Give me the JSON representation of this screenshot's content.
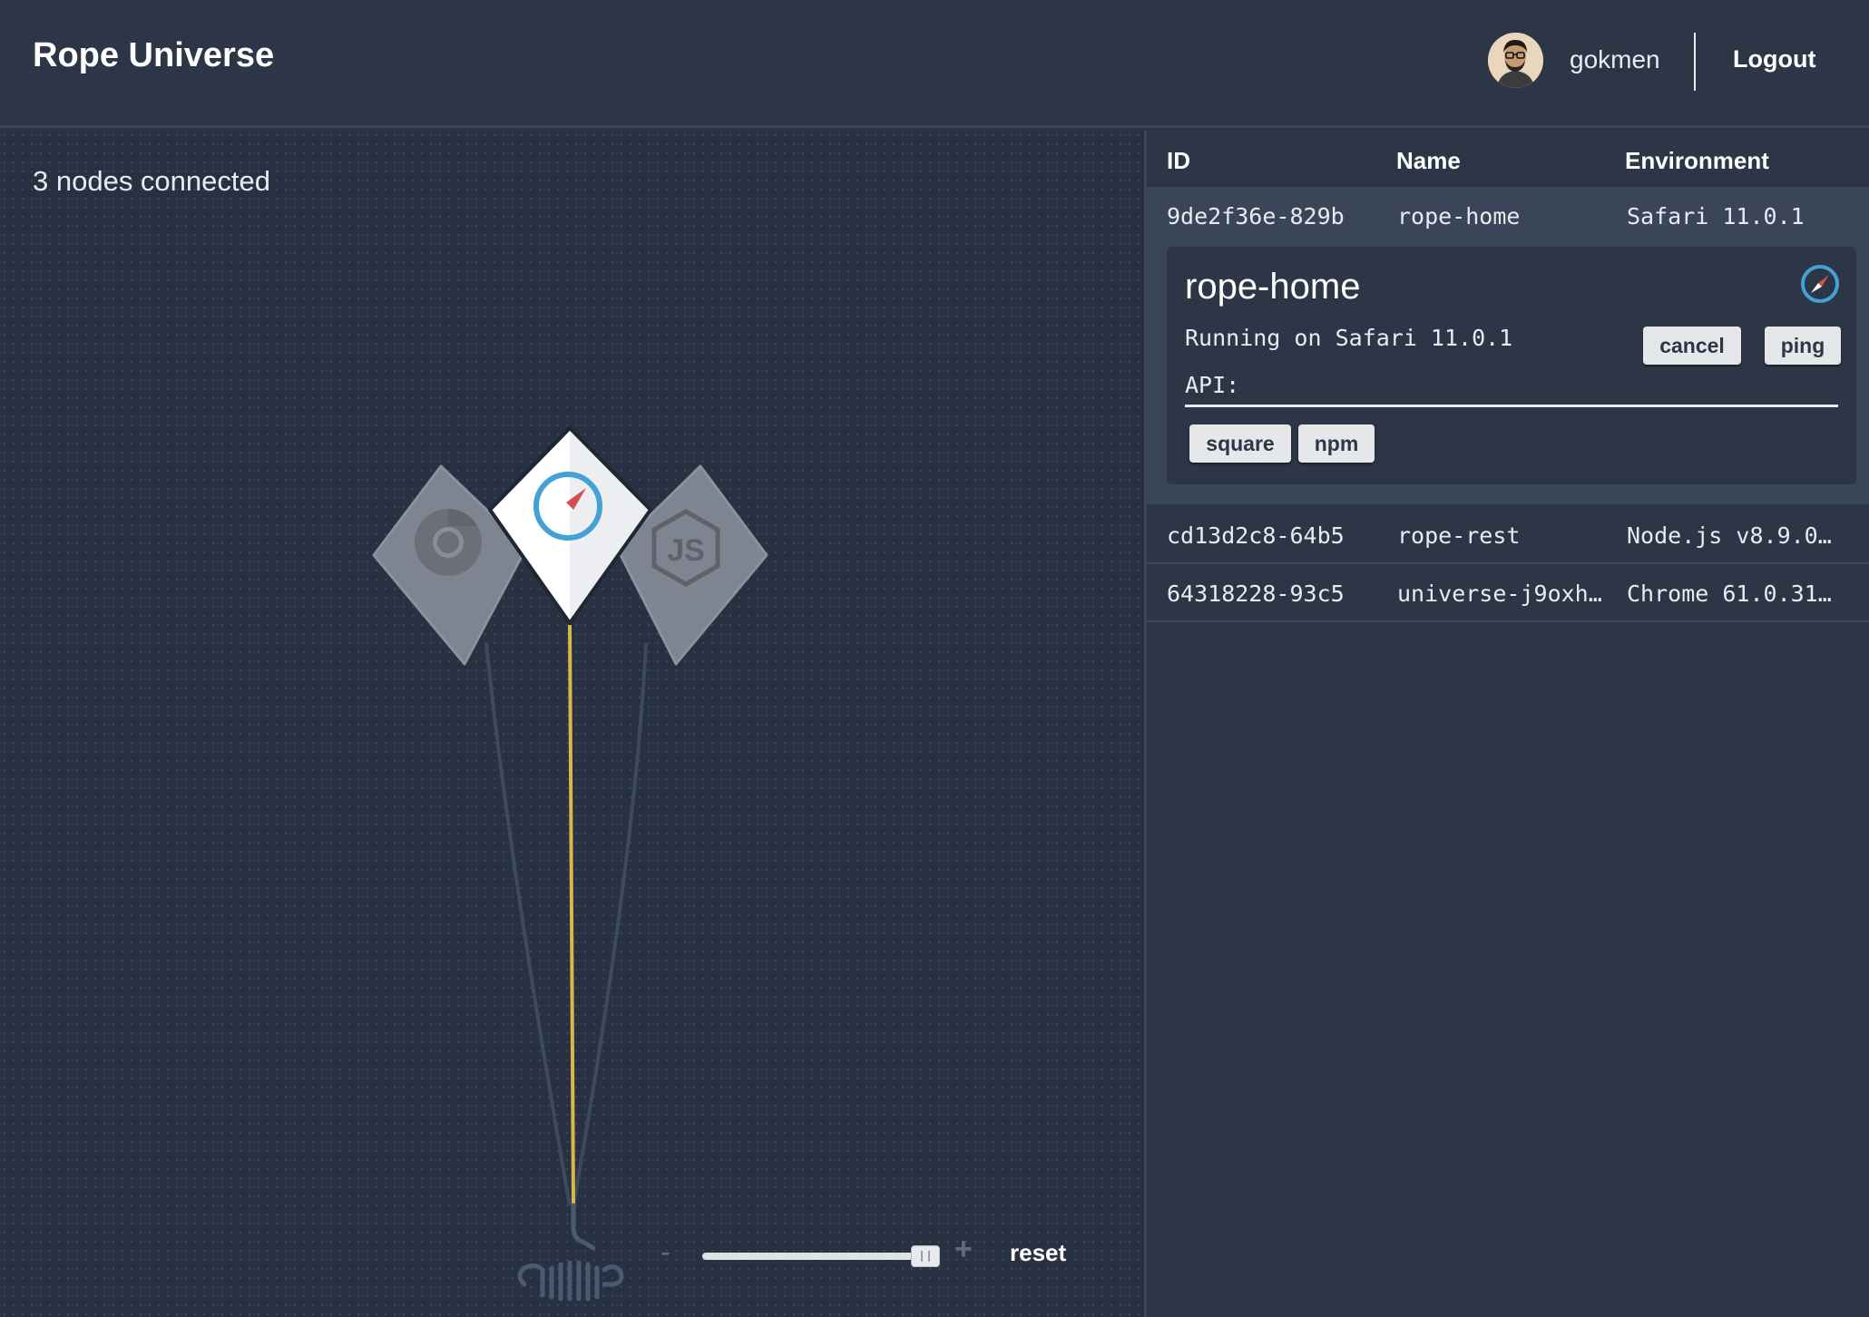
{
  "header": {
    "app_title": "Rope Universe",
    "username": "gokmen",
    "logout_label": "Logout"
  },
  "graph": {
    "status_text": "3 nodes connected",
    "nodes": [
      {
        "name": "chrome-node",
        "icon": "chrome-icon",
        "active": false
      },
      {
        "name": "safari-node",
        "icon": "safari-compass-icon",
        "active": true
      },
      {
        "name": "nodejs-node",
        "icon": "nodejs-icon",
        "active": false
      }
    ],
    "zoom": {
      "minus_label": "-",
      "plus_label": "+",
      "reset_label": "reset",
      "level_fraction": 0.97
    },
    "colors": {
      "active_rope": "#d8b945",
      "inactive_rope": "#3d4a5e",
      "accent_blue": "#44a1d4",
      "compass_needle": "#d5504c"
    }
  },
  "table": {
    "headers": {
      "id": "ID",
      "name": "Name",
      "environment": "Environment"
    },
    "rows": [
      {
        "id": "9de2f36e-829b",
        "name": "rope-home",
        "environment": "Safari 11.0.1"
      },
      {
        "id": "cd13d2c8-64b5",
        "name": "rope-rest",
        "environment": "Node.js v8.9.0…"
      },
      {
        "id": "64318228-93c5",
        "name": "universe-j9oxh…",
        "environment": "Chrome 61.0.31…"
      }
    ],
    "detail": {
      "title": "rope-home",
      "running_text": "Running on Safari 11.0.1",
      "api_label": "API:",
      "cancel_label": "cancel",
      "ping_label": "ping",
      "api_buttons": [
        "square",
        "npm"
      ]
    }
  }
}
